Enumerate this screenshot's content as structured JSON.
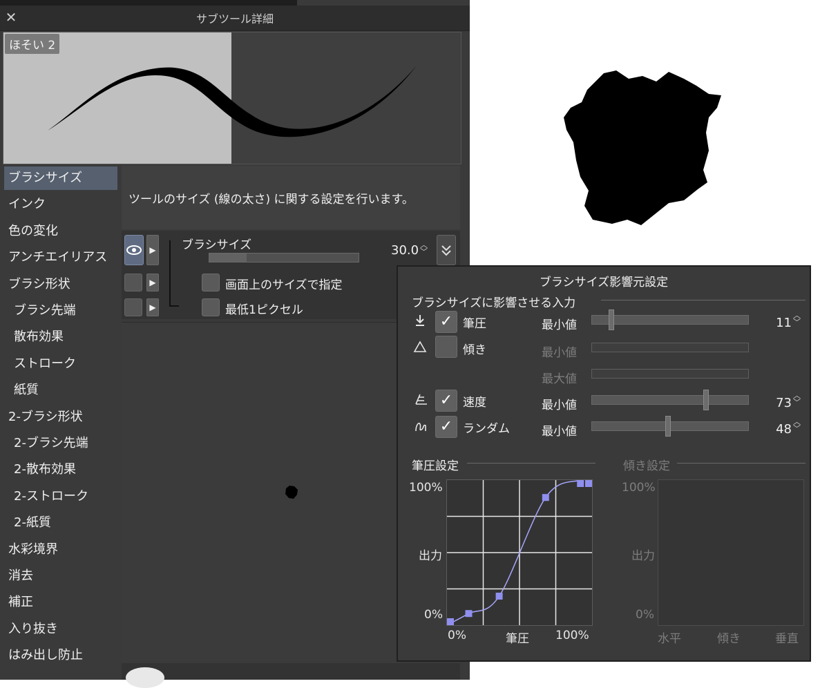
{
  "panel": {
    "title": "サブツール詳細",
    "close_glyph": "✕",
    "preview_name": "ほそい 2",
    "description": "ツールのサイズ (線の太さ) に関する設定を行います。"
  },
  "categories": [
    {
      "label": "ブラシサイズ",
      "sub": false,
      "selected": true
    },
    {
      "label": "インク",
      "sub": false
    },
    {
      "label": "色の変化",
      "sub": false
    },
    {
      "label": "アンチエイリアス",
      "sub": false
    },
    {
      "label": "ブラシ形状",
      "sub": false
    },
    {
      "label": "ブラシ先端",
      "sub": true
    },
    {
      "label": "散布効果",
      "sub": true
    },
    {
      "label": "ストローク",
      "sub": true
    },
    {
      "label": "紙質",
      "sub": true
    },
    {
      "label": "2-ブラシ形状",
      "sub": false
    },
    {
      "label": "2-ブラシ先端",
      "sub": true
    },
    {
      "label": "2-散布効果",
      "sub": true
    },
    {
      "label": "2-ストローク",
      "sub": true
    },
    {
      "label": "2-紙質",
      "sub": true
    },
    {
      "label": "水彩境界",
      "sub": false
    },
    {
      "label": "消去",
      "sub": false
    },
    {
      "label": "補正",
      "sub": false
    },
    {
      "label": "入り抜き",
      "sub": false
    },
    {
      "label": "はみ出し防止",
      "sub": false
    }
  ],
  "settings": {
    "brush_size_label": "ブラシサイズ",
    "brush_size_value": "30.0",
    "brush_size_fraction": 0.25,
    "screen_size_label": "画面上のサイズで指定",
    "min_pixel_label": "最低1ピクセル"
  },
  "popup": {
    "title": "ブラシサイズ影響元設定",
    "section_input": "ブラシサイズに影響させる入力",
    "rows": {
      "pressure": {
        "label": "筆圧",
        "checked": true,
        "min_label": "最小値",
        "value": "11",
        "fraction": 0.11
      },
      "tilt": {
        "label": "傾き",
        "checked": false,
        "min_label": "最小値",
        "max_label": "最大値"
      },
      "speed": {
        "label": "速度",
        "checked": true,
        "min_label": "最小値",
        "value": "73",
        "fraction": 0.73
      },
      "random": {
        "label": "ランダム",
        "checked": true,
        "min_label": "最小値",
        "value": "48",
        "fraction": 0.48
      }
    },
    "pressure_graph": {
      "title": "筆圧設定",
      "y_top": "100%",
      "y_mid": "出力",
      "y_bottom": "0%",
      "x_left": "0%",
      "x_mid": "筆圧",
      "x_right": "100%",
      "control_points": [
        [
          0,
          0
        ],
        [
          0.15,
          0.08
        ],
        [
          0.36,
          0.2
        ],
        [
          0.68,
          0.88
        ],
        [
          0.92,
          1.0
        ],
        [
          1.0,
          1.0
        ]
      ]
    },
    "tilt_graph": {
      "title": "傾き設定",
      "y_top": "100%",
      "y_mid": "出力",
      "y_bottom": "0%",
      "x_left": "水平",
      "x_mid": "傾き",
      "x_right": "垂直"
    }
  },
  "colors": {
    "panel_bg": "#3a3a3a",
    "selected_item": "#56606f",
    "curve_point": "#8f8ff0"
  }
}
